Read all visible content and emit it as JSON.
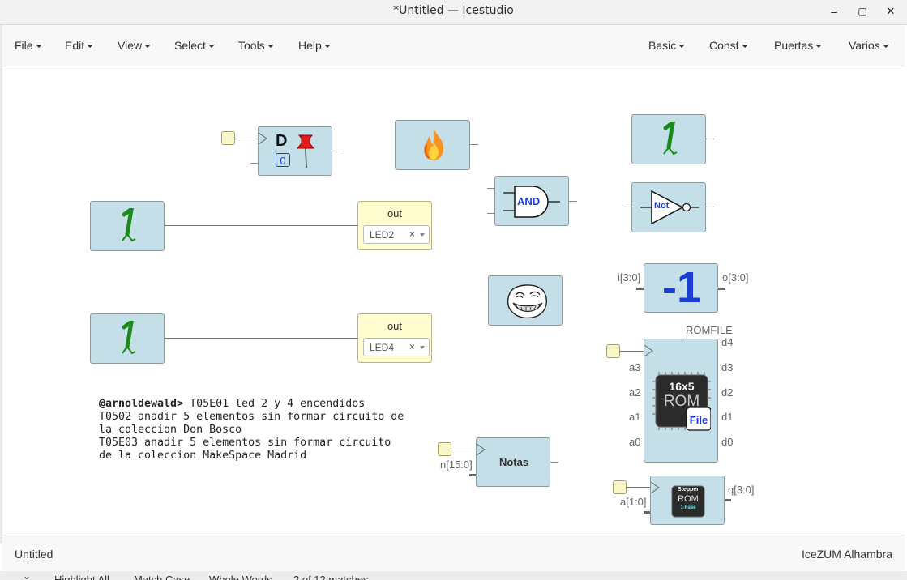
{
  "window": {
    "title": "*Untitled — Icestudio",
    "minimize": "–",
    "maximize": "▢",
    "close": "✕"
  },
  "menubar": {
    "left": [
      "File",
      "Edit",
      "View",
      "Select",
      "Tools",
      "Help"
    ],
    "right": [
      "Basic",
      "Const",
      "Puertas",
      "Varios"
    ]
  },
  "canvas": {
    "dff": {
      "letter": "D",
      "init": "0"
    },
    "and_gate": {
      "label": "AND"
    },
    "not_gate": {
      "label": "Not"
    },
    "out1": {
      "label": "out",
      "value": "LED2"
    },
    "out2": {
      "label": "out",
      "value": "LED4"
    },
    "clear_glyph": "×",
    "decrement": {
      "symbol": "-1",
      "in_label": "i[3:0]",
      "out_label": "o[3:0]"
    },
    "rom": {
      "param": "ROMFILE",
      "title": "16x5",
      "sub": "ROM",
      "file": "File",
      "inputs": [
        "a3",
        "a2",
        "a1",
        "a0"
      ],
      "outputs": [
        "d4",
        "d3",
        "d2",
        "d1",
        "d0"
      ]
    },
    "notas": {
      "label": "Notas",
      "in_label": "n[15:0]"
    },
    "stepper": {
      "l1": "Stepper",
      "l2": "ROM",
      "l3": "1-Fase",
      "in_label": "a[1:0]",
      "out_label": "q[3:0]"
    },
    "note_lines": [
      {
        "bold": "@arnoldewald>",
        "text": " T05E01 led 2 y 4 encendidos"
      },
      {
        "bold": "",
        "text": "T0502 anadir 5 elementos sin formar circuito de"
      },
      {
        "bold": "",
        "text": "la coleccion Don Bosco"
      },
      {
        "bold": "",
        "text": "T05E03 anadir 5 elementos sin formar circuito"
      },
      {
        "bold": "",
        "text": "de la coleccion MakeSpace Madrid"
      }
    ]
  },
  "statusbar": {
    "left": "Untitled",
    "right": "IceZUM Alhambra"
  },
  "findbar": {
    "items": [
      "Highlight All",
      "Match Case",
      "Whole Words",
      "2 of 12 matches"
    ]
  },
  "icons": [
    "one-icon",
    "fire-icon",
    "pushpin-icon",
    "troll-face-icon",
    "rom-chip-icon"
  ]
}
